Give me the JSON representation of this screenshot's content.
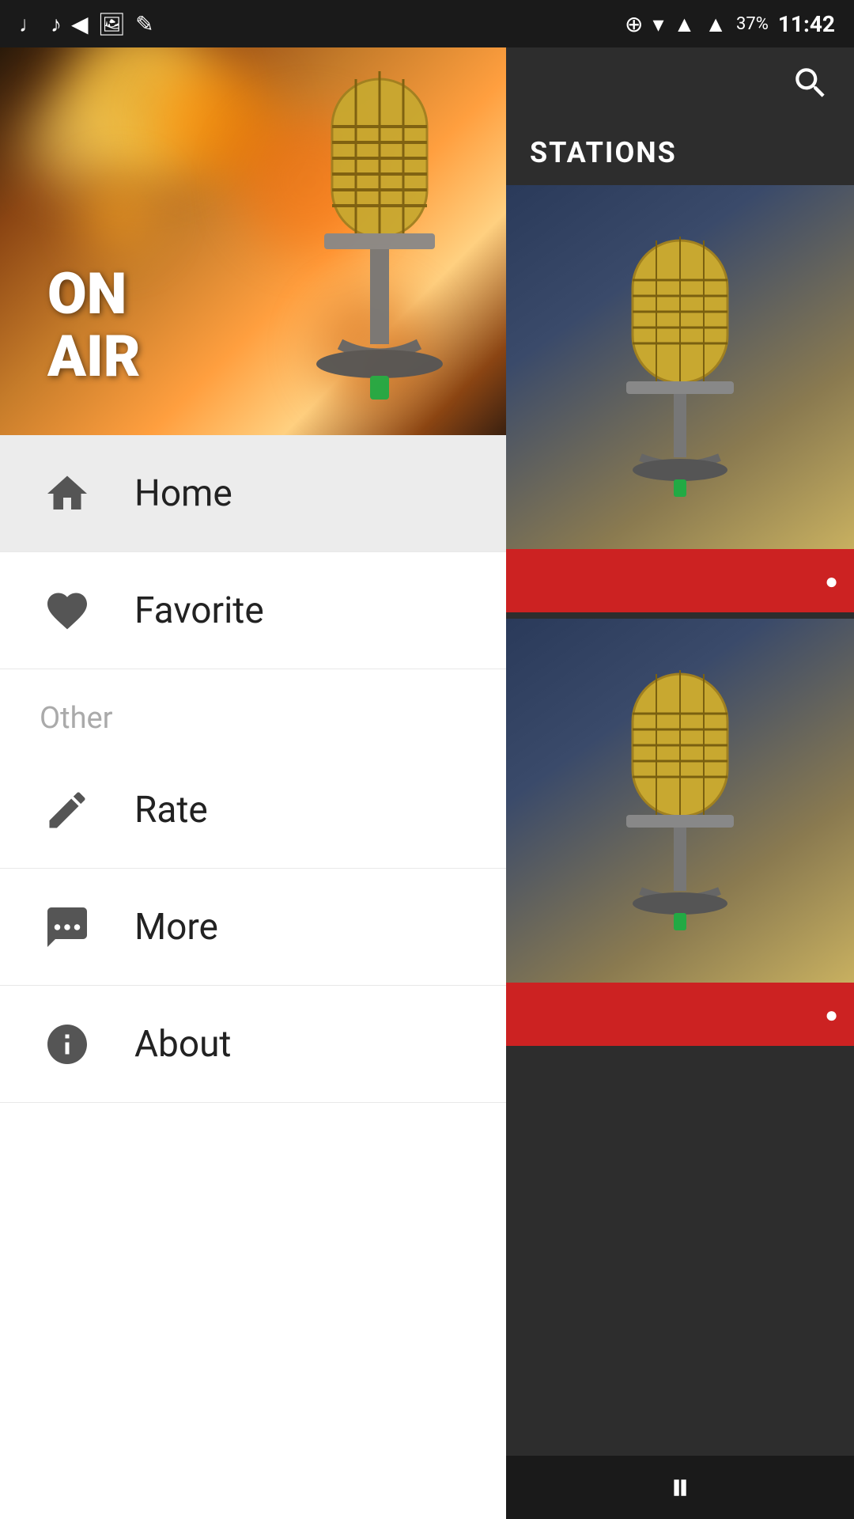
{
  "statusBar": {
    "time": "11:42",
    "battery": "37%",
    "icons": [
      "music-note-1",
      "music-note-2",
      "back-arrow",
      "image",
      "edit"
    ]
  },
  "hero": {
    "onAirText": "ON\nAIR"
  },
  "drawer": {
    "navItems": [
      {
        "id": "home",
        "label": "Home",
        "icon": "home"
      },
      {
        "id": "favorite",
        "label": "Favorite",
        "icon": "heart"
      }
    ],
    "sectionHeader": "Other",
    "otherItems": [
      {
        "id": "rate",
        "label": "Rate",
        "icon": "rate"
      },
      {
        "id": "more",
        "label": "More",
        "icon": "more"
      },
      {
        "id": "about",
        "label": "About",
        "icon": "info"
      }
    ]
  },
  "rightPanel": {
    "stationsLabel": "STATIONS",
    "searchIcon": "search",
    "cards": [
      {
        "id": "card-1",
        "redBarText": "○"
      },
      {
        "id": "card-2",
        "redBarText": "○"
      }
    ]
  },
  "player": {
    "pauseIcon": "pause"
  }
}
